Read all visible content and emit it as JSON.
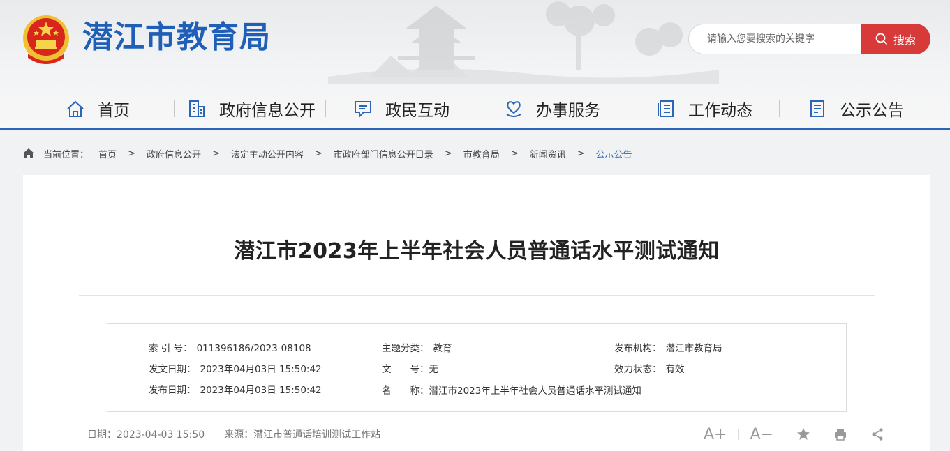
{
  "header": {
    "site_title": "潜江市教育局",
    "search_placeholder": "请输入您要搜索的关键字",
    "search_button": "搜索"
  },
  "nav": {
    "items": [
      {
        "label": "首页",
        "icon": "home-icon"
      },
      {
        "label": "政府信息公开",
        "icon": "building-icon"
      },
      {
        "label": "政民互动",
        "icon": "chat-icon"
      },
      {
        "label": "办事服务",
        "icon": "heart-hand-icon"
      },
      {
        "label": "工作动态",
        "icon": "list-icon"
      },
      {
        "label": "公示公告",
        "icon": "document-icon"
      }
    ]
  },
  "breadcrumb": {
    "label": "当前位置：",
    "items": [
      "首页",
      "政府信息公开",
      "法定主动公开内容",
      "市政府部门信息公开目录",
      "市教育局",
      "新闻资讯",
      "公示公告"
    ]
  },
  "article": {
    "title": "潜江市2023年上半年社会人员普通话水平测试通知",
    "meta": {
      "index_key": "索 引 号：",
      "index_val": "011396186/2023-08108",
      "doc_date_key": "发文日期：",
      "doc_date_val": "2023年04月03日 15:50:42",
      "pub_date_key": "发布日期：",
      "pub_date_val": "2023年04月03日 15:50:42",
      "topic_key": "主题分类：",
      "topic_val": "教育",
      "docno_key": "文　　号：",
      "docno_val": "无",
      "name_key": "名　　称：",
      "name_val": "潜江市2023年上半年社会人员普通话水平测试通知",
      "org_key": "发布机构：",
      "org_val": "潜江市教育局",
      "status_key": "效力状态：",
      "status_val": "有效"
    },
    "date_line": "日期：2023-04-03 15:50",
    "source_line": "来源：潜江市普通话培训测试工作站"
  },
  "tools": {
    "font_up": "A+",
    "font_down": "A−"
  },
  "colors": {
    "brand_blue": "#1f5fb8",
    "nav_line": "#2b65b7",
    "search_red": "#d83a3a",
    "crumb_current": "#2b65b7"
  }
}
